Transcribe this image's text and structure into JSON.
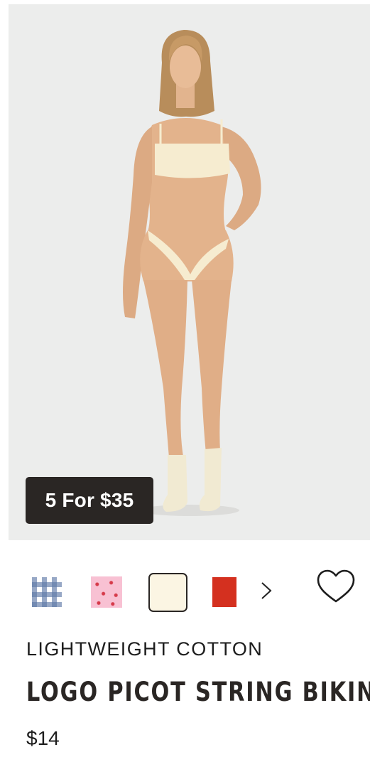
{
  "product": {
    "promo_badge": "5 For $35",
    "subtitle": "LIGHTWEIGHT COTTON",
    "title": "LOGO PICOT STRING BIKINI",
    "price": "$14"
  },
  "swatches": [
    {
      "name": "blue-gingham",
      "color": "#5f7aa8"
    },
    {
      "name": "pink-heart-print",
      "color": "#f8c1d3"
    },
    {
      "name": "cream",
      "color": "#fbf5e3",
      "selected": true
    },
    {
      "name": "red",
      "color": "#d4301f"
    }
  ],
  "icons": {
    "next": "chevron-right-icon",
    "wishlist": "heart-outline-icon"
  },
  "colors": {
    "badge_bg": "#2a2624",
    "image_bg": "#ecedec",
    "text": "#1d1d1d"
  }
}
